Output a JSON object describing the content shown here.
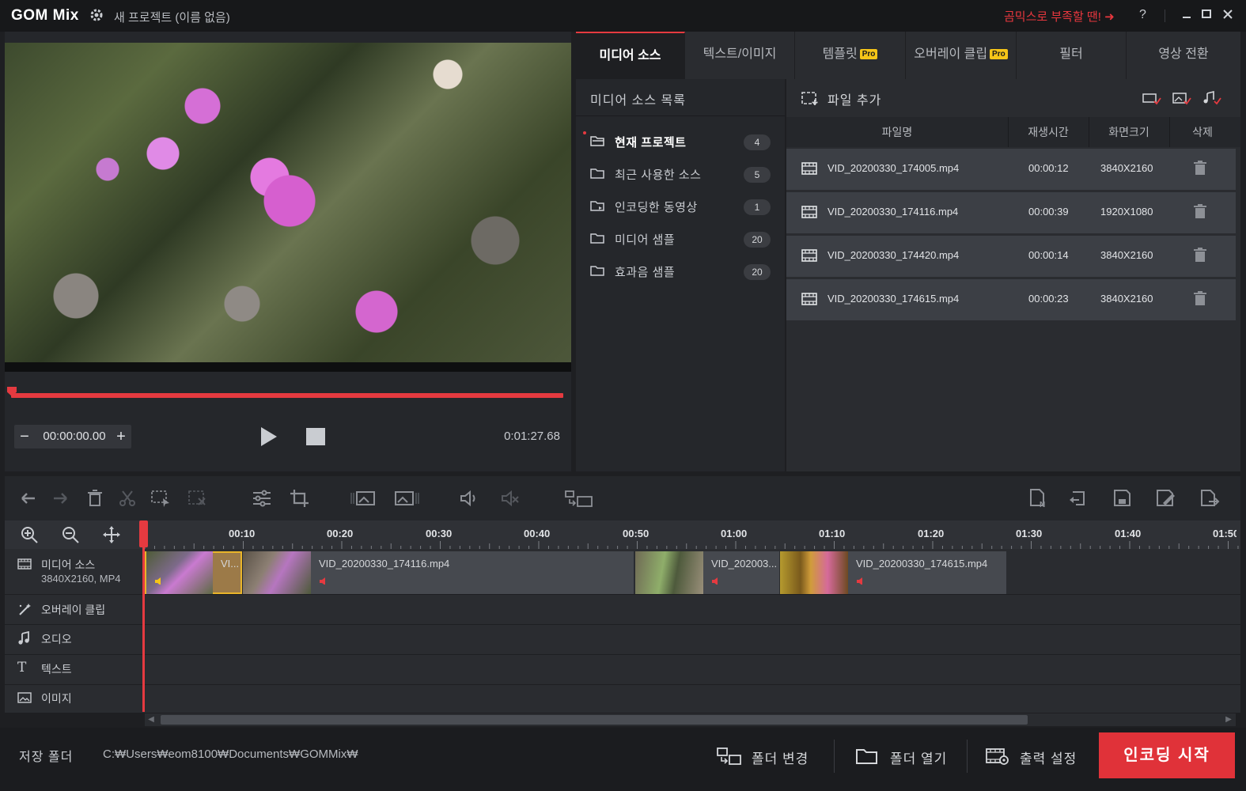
{
  "titlebar": {
    "logo": "GOM Mix",
    "project_title": "새 프로젝트 (이름 없음)",
    "promo": "곰믹스로 부족할 땐! ➜",
    "help": "?"
  },
  "preview": {
    "current_time": "00:00:00.00",
    "total_time": "0:01:27.68",
    "progress": 0.0
  },
  "tabs": [
    {
      "label": "미디어 소스",
      "active": true,
      "pro": false
    },
    {
      "label": "텍스트/이미지",
      "active": false,
      "pro": false
    },
    {
      "label": "템플릿",
      "active": false,
      "pro": true
    },
    {
      "label": "오버레이 클립",
      "active": false,
      "pro": true
    },
    {
      "label": "필터",
      "active": false,
      "pro": false
    },
    {
      "label": "영상 전환",
      "active": false,
      "pro": false
    }
  ],
  "pro_badge": "Pro",
  "media_source": {
    "list_title": "미디어 소스 목록",
    "items": [
      {
        "label": "현재 프로젝트",
        "count": "4"
      },
      {
        "label": "최근 사용한 소스",
        "count": "5"
      },
      {
        "label": "인코딩한 동영상",
        "count": "1"
      },
      {
        "label": "미디어 샘플",
        "count": "20"
      },
      {
        "label": "효과음 샘플",
        "count": "20"
      }
    ],
    "add_file": "파일 추가",
    "columns": {
      "name": "파일명",
      "duration": "재생시간",
      "resolution": "화면크기",
      "delete": "삭제"
    },
    "files": [
      {
        "name": "VID_20200330_174005.mp4",
        "duration": "00:00:12",
        "resolution": "3840X2160"
      },
      {
        "name": "VID_20200330_174116.mp4",
        "duration": "00:00:39",
        "resolution": "1920X1080"
      },
      {
        "name": "VID_20200330_174420.mp4",
        "duration": "00:00:14",
        "resolution": "3840X2160"
      },
      {
        "name": "VID_20200330_174615.mp4",
        "duration": "00:00:23",
        "resolution": "3840X2160"
      }
    ]
  },
  "timeline": {
    "ticks": [
      "00:10",
      "00:20",
      "00:30",
      "00:40",
      "00:50",
      "01:00",
      "01:10",
      "01:20",
      "01:30",
      "01:40",
      "01:50"
    ],
    "tracks": {
      "media_name": "미디어 소스",
      "media_info": "3840X2160, MP4",
      "overlay": "오버레이 클립",
      "audio": "오디오",
      "text": "텍스트",
      "image": "이미지"
    },
    "clips": [
      {
        "label": "VI..."
      },
      {
        "label": "VID_20200330_174116.mp4"
      },
      {
        "label": "VID_202003..."
      },
      {
        "label": "VID_20200330_174615.mp4"
      }
    ]
  },
  "bottom": {
    "save_folder_label": "저장 폴더",
    "save_path": "C:₩Users₩eom8100₩Documents₩GOMMix₩",
    "change_folder": "폴더 변경",
    "open_folder": "폴더 열기",
    "output_settings": "출력 설정",
    "encode_start": "인코딩 시작"
  },
  "colors": {
    "accent": "#e53a40",
    "pro_badge": "#f5c518",
    "background": "#1e1f22"
  }
}
